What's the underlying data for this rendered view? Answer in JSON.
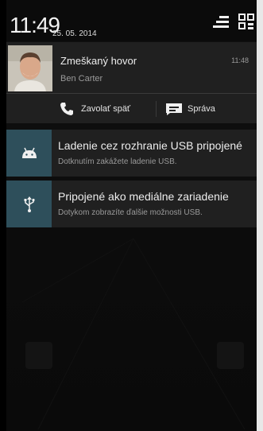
{
  "status_bar": {
    "time": "11:49",
    "date": "25. 05. 2014",
    "settings_icon": "settings-sliders-icon",
    "quick_settings_icon": "quick-settings-grid-icon"
  },
  "notifications": {
    "missed_call": {
      "title": "Zmeškaný hovor",
      "caller": "Ben Carter",
      "time": "11:48",
      "actions": {
        "call_back_label": "Zavolať späť",
        "message_label": "Správa"
      }
    },
    "usb_debugging": {
      "icon": "android-icon",
      "title": "Ladenie cez rozhranie USB pripojené",
      "subtitle": "Dotknutím zakážete ladenie USB."
    },
    "media_device": {
      "icon": "usb-icon",
      "title": "Pripojené ako mediálne zariadenie",
      "subtitle": "Dotykom zobrazíte ďalšie možnosti USB."
    }
  },
  "colors": {
    "icon_tile": "#2e4f5b",
    "card_bg": "#202020"
  }
}
